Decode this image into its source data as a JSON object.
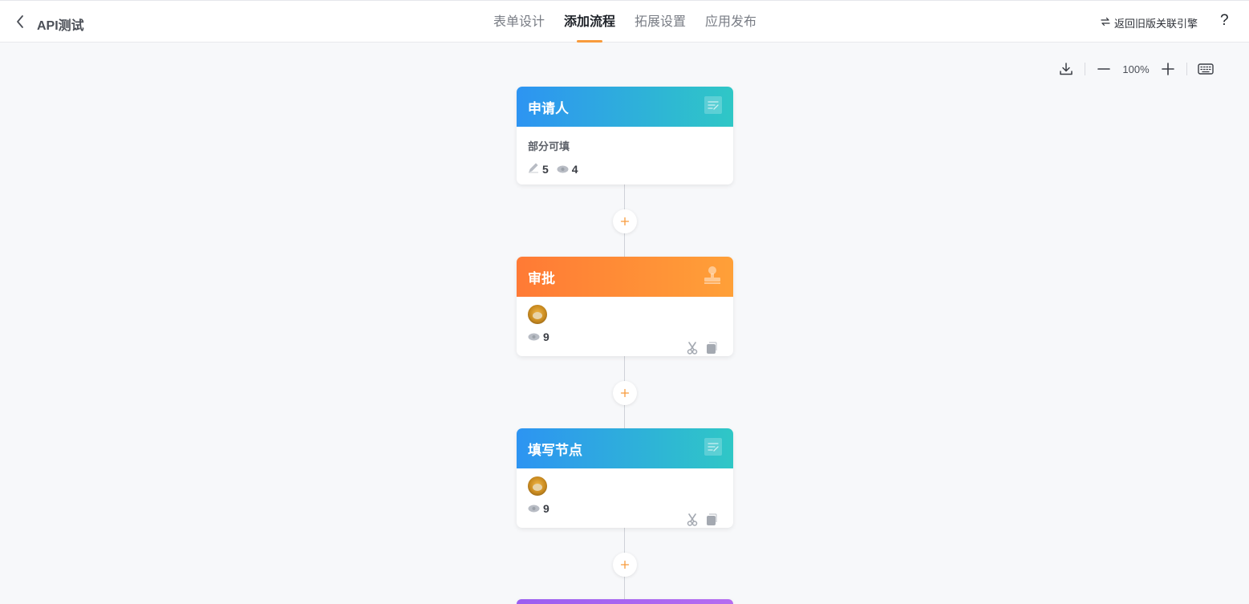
{
  "header": {
    "app_title": "API测试",
    "tabs": [
      {
        "label": "表单设计",
        "active": false
      },
      {
        "label": "添加流程",
        "active": true
      },
      {
        "label": "拓展设置",
        "active": false
      },
      {
        "label": "应用发布",
        "active": false
      }
    ],
    "legacy_engine_link": "返回旧版关联引擎",
    "help_label": "?"
  },
  "canvas_toolbar": {
    "zoom": "100%"
  },
  "nodes": [
    {
      "title": "申请人",
      "subtitle": "部分可填",
      "edit_count": "5",
      "view_count": "4",
      "header_color": "#2d94f2"
    },
    {
      "title": "审批",
      "view_count": "9",
      "header_color": "#ff7a35"
    },
    {
      "title": "填写节点",
      "view_count": "9",
      "header_color": "#2d94f2"
    }
  ],
  "add_button_symbol": "+",
  "colors": {
    "accent": "#f89b3c",
    "blue_start": "#2d94f2",
    "blue_end": "#2fc7c6",
    "orange_start": "#ff7a35",
    "orange_end": "#ffa038",
    "purple": "#9a5ef0"
  }
}
